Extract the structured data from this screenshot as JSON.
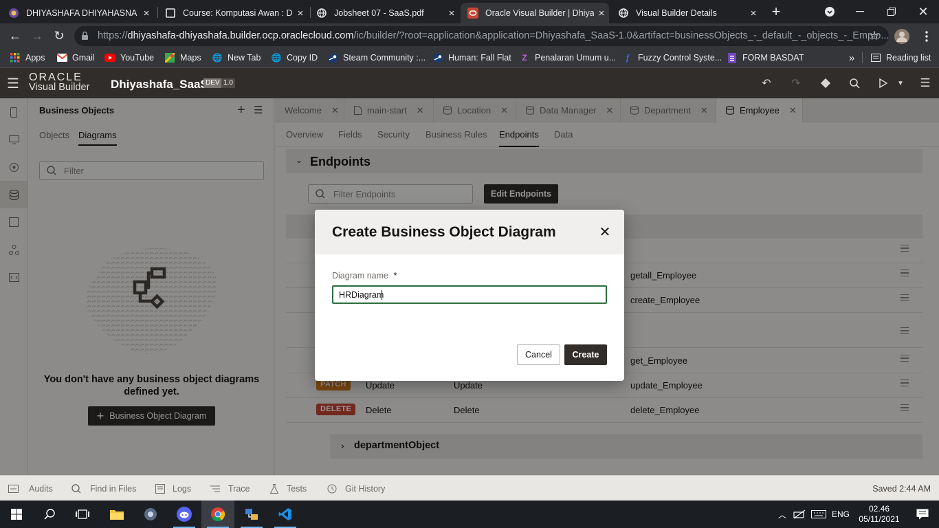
{
  "browser": {
    "tabs": [
      {
        "title": "DHIYASHAFA DHIYAHASNA H",
        "icon": "university-crest-icon",
        "active": false
      },
      {
        "title": "Course: Komputasi Awan : Di",
        "icon": "moodle-page-icon",
        "active": false
      },
      {
        "title": "Jobsheet 07 - SaaS.pdf",
        "icon": "globe-icon",
        "active": false
      },
      {
        "title": "Oracle Visual Builder | Dhiyas",
        "icon": "oracle-icon",
        "active": true
      },
      {
        "title": "Visual Builder Details",
        "icon": "globe-icon",
        "active": false
      }
    ],
    "url_prefix": "https://",
    "url_domain": "dhiyashafa-dhiyashafa.builder.ocp.oraclecloud.com",
    "url_path": "/ic/builder/?root=application&application=Dhiyashafa_SaaS-1.0&artifact=businessObjects_-_default_-_objects_-_Emplo...",
    "bookmarks": [
      {
        "label": "Apps",
        "icon": "apps-grid-icon"
      },
      {
        "label": "Gmail",
        "icon": "gmail-icon"
      },
      {
        "label": "YouTube",
        "icon": "youtube-icon"
      },
      {
        "label": "Maps",
        "icon": "maps-icon"
      },
      {
        "label": "New Tab",
        "icon": "globe-icon"
      },
      {
        "label": "Copy ID",
        "icon": "globe-icon"
      },
      {
        "label": "Steam Community :...",
        "icon": "steam-icon"
      },
      {
        "label": "Human: Fall Flat",
        "icon": "steam-icon"
      },
      {
        "label": "Penalaran Umum u...",
        "icon": "zenius-icon"
      },
      {
        "label": "Fuzzy Control Syste...",
        "icon": "scikit-icon"
      },
      {
        "label": "FORM BASDAT",
        "icon": "forms-icon"
      }
    ],
    "more_bookmarks": "»",
    "reading_list": "Reading list"
  },
  "vb": {
    "logo_line1": "ORACLE",
    "logo_line2": "Visual Builder",
    "app_name": "Dhiyashafa_SaaS",
    "dev_badge": "DEV",
    "version_badge": "1.0"
  },
  "bo_panel": {
    "title": "Business Objects",
    "tabs": [
      "Objects",
      "Diagrams"
    ],
    "active_tab": "Diagrams",
    "filter_placeholder": "Filter",
    "empty_message": "You don't have any business object diagrams defined yet.",
    "add_button": "Business Object Diagram"
  },
  "editor_tabs": [
    {
      "label": "Welcome",
      "icon": ""
    },
    {
      "label": "main-start",
      "icon": "page-icon"
    },
    {
      "label": "Location",
      "icon": "database-icon"
    },
    {
      "label": "Data Manager",
      "icon": "database-icon"
    },
    {
      "label": "Department",
      "icon": "database-icon"
    },
    {
      "label": "Employee",
      "icon": "database-icon"
    }
  ],
  "sub_tabs": [
    "Overview",
    "Fields",
    "Security",
    "Business Rules",
    "Endpoints",
    "Data"
  ],
  "active_sub_tab": "Endpoints",
  "endpoints": {
    "section_title": "Endpoints",
    "filter_placeholder": "Filter Endpoints",
    "edit_button": "Edit Endpoints",
    "rows": [
      {
        "method": "",
        "name": "",
        "label": "",
        "id": "getall_Employee"
      },
      {
        "method": "",
        "name": "",
        "label": "",
        "id": "create_Employee"
      },
      {
        "method": "",
        "name": "",
        "label": "",
        "id": "get_Employee"
      },
      {
        "method": "PATCH",
        "name": "Update",
        "label": "Update",
        "id": "update_Employee",
        "color": "#d27c1c"
      },
      {
        "method": "DELETE",
        "name": "Delete",
        "label": "Delete",
        "id": "delete_Employee",
        "color": "#c74634"
      }
    ],
    "child_group": "departmentObject"
  },
  "dialog": {
    "title": "Create Business Object Diagram",
    "field_label": "Diagram name",
    "required_mark": "*",
    "field_value": "HRDiagram",
    "cancel": "Cancel",
    "create": "Create"
  },
  "statusbar": {
    "items": [
      "Audits",
      "Find in Files",
      "Logs",
      "Trace",
      "Tests",
      "Git History"
    ],
    "saved": "Saved 2:44 AM"
  },
  "taskbar": {
    "language": "ENG",
    "time": "02.46",
    "date": "05/11/2021"
  },
  "colors": {
    "vb_header": "#312d2a",
    "create_button": "#312d2a",
    "patch": "#d27c1c",
    "delete": "#c74634",
    "chrome_dark": "#202124"
  }
}
